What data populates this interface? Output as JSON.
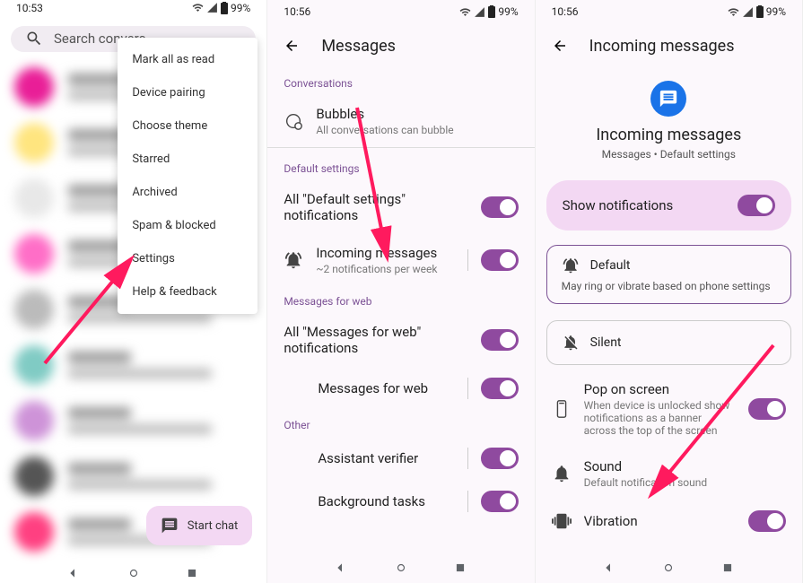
{
  "screen1": {
    "time": "10:53",
    "battery": "99%",
    "search_placeholder": "Search convers",
    "menu": [
      "Mark all as read",
      "Device pairing",
      "Choose theme",
      "Starred",
      "Archived",
      "Spam & blocked",
      "Settings",
      "Help & feedback"
    ],
    "fab": "Start chat"
  },
  "screen2": {
    "time": "10:56",
    "battery": "99%",
    "title": "Messages",
    "sections": {
      "conversations": "Conversations",
      "default_settings": "Default settings",
      "messages_for_web": "Messages for web",
      "other": "Other"
    },
    "bubbles": {
      "title": "Bubbles",
      "sub": "All conversations can bubble"
    },
    "all_default": "All \"Default settings\" notifications",
    "incoming": {
      "title": "Incoming messages",
      "sub": "~2 notifications per week"
    },
    "all_web": "All \"Messages for web\" notifications",
    "web": "Messages for web",
    "assistant": "Assistant verifier",
    "background": "Background tasks"
  },
  "screen3": {
    "time": "10:56",
    "battery": "99%",
    "title": "Incoming messages",
    "page_title": "Incoming messages",
    "page_sub": "Messages • Default settings",
    "show_notif": "Show notifications",
    "default": {
      "title": "Default",
      "sub": "May ring or vibrate based on phone settings"
    },
    "silent": "Silent",
    "pop": {
      "title": "Pop on screen",
      "sub": "When device is unlocked show notifications as a banner across the top of the screen"
    },
    "sound": {
      "title": "Sound",
      "sub": "Default notification sound"
    },
    "vibration": "Vibration"
  }
}
